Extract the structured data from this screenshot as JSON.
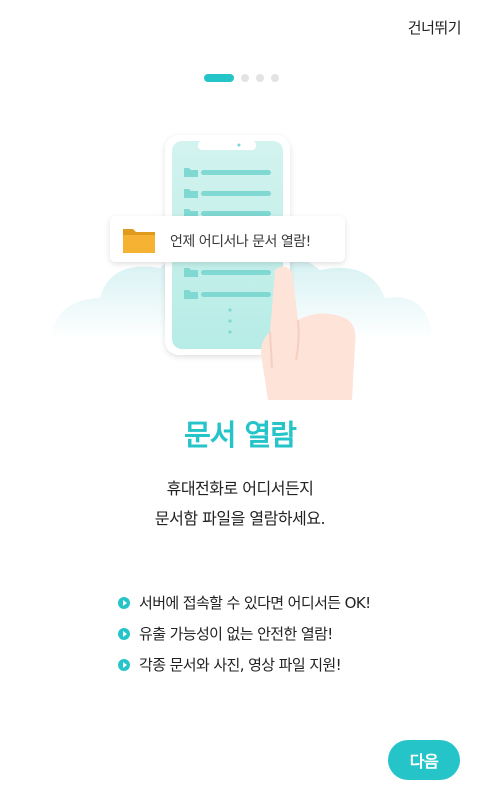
{
  "header": {
    "skip_label": "건너뛰기"
  },
  "pagination": {
    "total": 4,
    "current": 1
  },
  "illustration": {
    "bubble_text": "언제 어디서나 문서 열람!"
  },
  "content": {
    "title": "문서 열람",
    "description_line1": "휴대전화로 어디서든지",
    "description_line2": "문서함 파일을 열람하세요.",
    "features": [
      "서버에 접속할 수 있다면 어디서든 OK!",
      "유출 가능성이 없는 안전한 열람!",
      "각종 문서와 사진, 영상 파일 지원!"
    ]
  },
  "footer": {
    "next_label": "다음"
  },
  "colors": {
    "accent": "#25c4c8",
    "folder": "#f5b233",
    "hand": "#fde3d8"
  }
}
